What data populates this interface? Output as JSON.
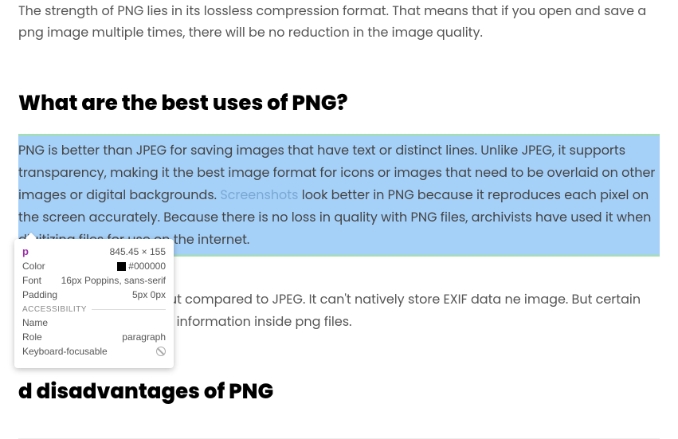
{
  "intro": "The strength of PNG lies in its lossless compression format. That means that if you open and save a png image multiple times, there will be no reduction in the image quality.",
  "heading1": "What are the best uses of PNG?",
  "highlighted": {
    "t1": "PNG is better than JPEG for saving images that have text or distinct lines. Unlike JPEG, it supports transparency, making it the best image format for icons or images that need to be overlaid on other images or digital backgrounds. ",
    "link": "Screenshots",
    "t2": " look better in PNG because it reproduces each pixel on the screen accurately. Because there is no loss in quality with PNG files, archivists have used it when digitizing files for use on the internet."
  },
  "paragraph_after": " is its larger file size output compared to JPEG. It can't natively store EXIF data ne image. But certain tools can embed textual information inside png files.",
  "heading2_partial": "d disadvantages of PNG",
  "tooltip": {
    "tag": "p",
    "dims": "845.45 × 155",
    "rows": {
      "color_label": "Color",
      "color_value": "#000000",
      "font_label": "Font",
      "font_value": "16px Poppins, sans-serif",
      "padding_label": "Padding",
      "padding_value": "5px 0px"
    },
    "section_label": "ACCESSIBILITY",
    "a11y": {
      "name_label": "Name",
      "name_value": "",
      "role_label": "Role",
      "role_value": "paragraph",
      "kf_label": "Keyboard-focusable"
    }
  }
}
